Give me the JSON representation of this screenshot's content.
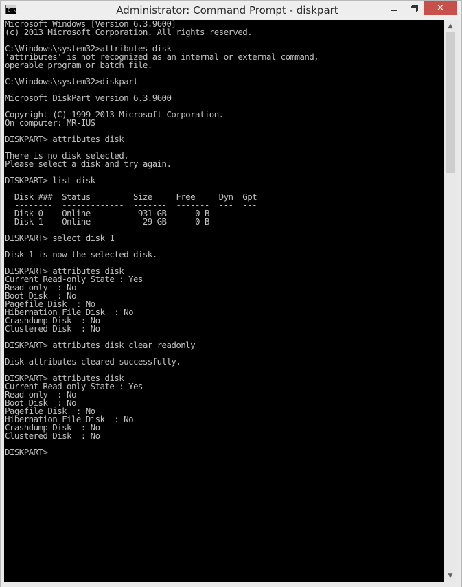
{
  "window": {
    "title": "Administrator: Command Prompt - diskpart",
    "controls": {
      "minimize": "minimize",
      "maximize": "maximize",
      "close": "✕"
    },
    "icon_text": "C:\\_"
  },
  "console": {
    "lines": [
      "Microsoft Windows [Version 6.3.9600]",
      "(c) 2013 Microsoft Corporation. All rights reserved.",
      "",
      "C:\\Windows\\system32>attributes disk",
      "'attributes' is not recognized as an internal or external command,",
      "operable program or batch file.",
      "",
      "C:\\Windows\\system32>diskpart",
      "",
      "Microsoft DiskPart version 6.3.9600",
      "",
      "Copyright (C) 1999-2013 Microsoft Corporation.",
      "On computer: MR-IUS",
      "",
      "DISKPART> attributes disk",
      "",
      "There is no disk selected.",
      "Please select a disk and try again.",
      "",
      "DISKPART> list disk",
      "",
      "  Disk ###  Status         Size     Free     Dyn  Gpt",
      "  --------  -------------  -------  -------  ---  ---",
      "  Disk 0    Online          931 GB      0 B",
      "  Disk 1    Online           29 GB      0 B",
      "",
      "DISKPART> select disk 1",
      "",
      "Disk 1 is now the selected disk.",
      "",
      "DISKPART> attributes disk",
      "Current Read-only State : Yes",
      "Read-only  : No",
      "Boot Disk  : No",
      "Pagefile Disk  : No",
      "Hibernation File Disk  : No",
      "Crashdump Disk  : No",
      "Clustered Disk  : No",
      "",
      "DISKPART> attributes disk clear readonly",
      "",
      "Disk attributes cleared successfully.",
      "",
      "DISKPART> attributes disk",
      "Current Read-only State : Yes",
      "Read-only  : No",
      "Boot Disk  : No",
      "Pagefile Disk  : No",
      "Hibernation File Disk  : No",
      "Crashdump Disk  : No",
      "Clustered Disk  : No",
      "",
      "DISKPART>"
    ]
  },
  "scrollbar": {
    "up_arrow": "▲",
    "down_arrow": "▼"
  },
  "colors": {
    "console_bg": "#000000",
    "console_text": "#c0c0c0",
    "close_button": "#c7504a"
  }
}
